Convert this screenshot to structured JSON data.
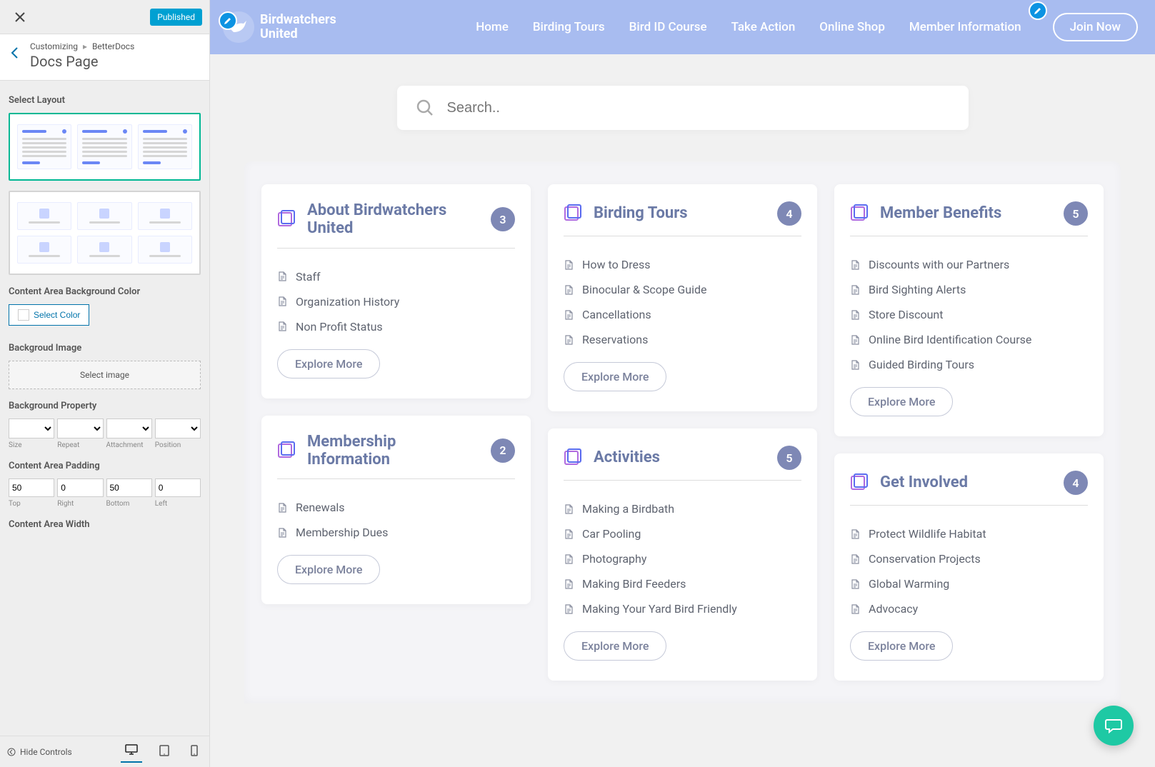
{
  "customizer": {
    "status_badge": "Published",
    "breadcrumb_root": "Customizing",
    "breadcrumb_section": "BetterDocs",
    "title": "Docs Page",
    "labels": {
      "select_layout": "Select Layout",
      "content_bg": "Content Area Background Color",
      "select_color": "Select Color",
      "bg_image": "Backgroud Image",
      "select_image": "Select image",
      "bg_property": "Background Property",
      "prop_size": "Size",
      "prop_repeat": "Repeat",
      "prop_attachment": "Attachment",
      "prop_position": "Position",
      "content_padding": "Content Area Padding",
      "pad_top_label": "Top",
      "pad_right_label": "Right",
      "pad_bottom_label": "Bottom",
      "pad_left_label": "Left",
      "content_width": "Content Area Width"
    },
    "padding": {
      "top": "50",
      "right": "0",
      "bottom": "50",
      "left": "0"
    },
    "footer": {
      "hide": "Hide Controls"
    }
  },
  "site": {
    "brand_line1": "Birdwatchers",
    "brand_line2": "United",
    "nav": {
      "home": "Home",
      "tours": "Birding Tours",
      "course": "Bird ID Course",
      "action": "Take Action",
      "shop": "Online Shop",
      "member": "Member Information"
    },
    "join": "Join Now",
    "search_placeholder": "Search.."
  },
  "explore_label": "Explore More",
  "cards": {
    "about": {
      "title": "About Birdwatchers United",
      "count": "3",
      "items": [
        "Staff",
        "Organization History",
        "Non Profit Status"
      ]
    },
    "tours": {
      "title": "Birding Tours",
      "count": "4",
      "items": [
        "How to Dress",
        "Binocular & Scope Guide",
        "Cancellations",
        "Reservations"
      ]
    },
    "benefits": {
      "title": "Member Benefits",
      "count": "5",
      "items": [
        "Discounts with our Partners",
        "Bird Sighting Alerts",
        "Store Discount",
        "Online Bird Identification Course",
        "Guided Birding Tours"
      ]
    },
    "membership": {
      "title": "Membership Information",
      "count": "2",
      "items": [
        "Renewals",
        "Membership Dues"
      ]
    },
    "activities": {
      "title": "Activities",
      "count": "5",
      "items": [
        "Making a Birdbath",
        "Car Pooling",
        "Photography",
        "Making Bird Feeders",
        "Making Your Yard Bird Friendly"
      ]
    },
    "involved": {
      "title": "Get Involved",
      "count": "4",
      "items": [
        "Protect Wildlife Habitat",
        "Conservation Projects",
        "Global Warming",
        "Advocacy"
      ]
    }
  }
}
